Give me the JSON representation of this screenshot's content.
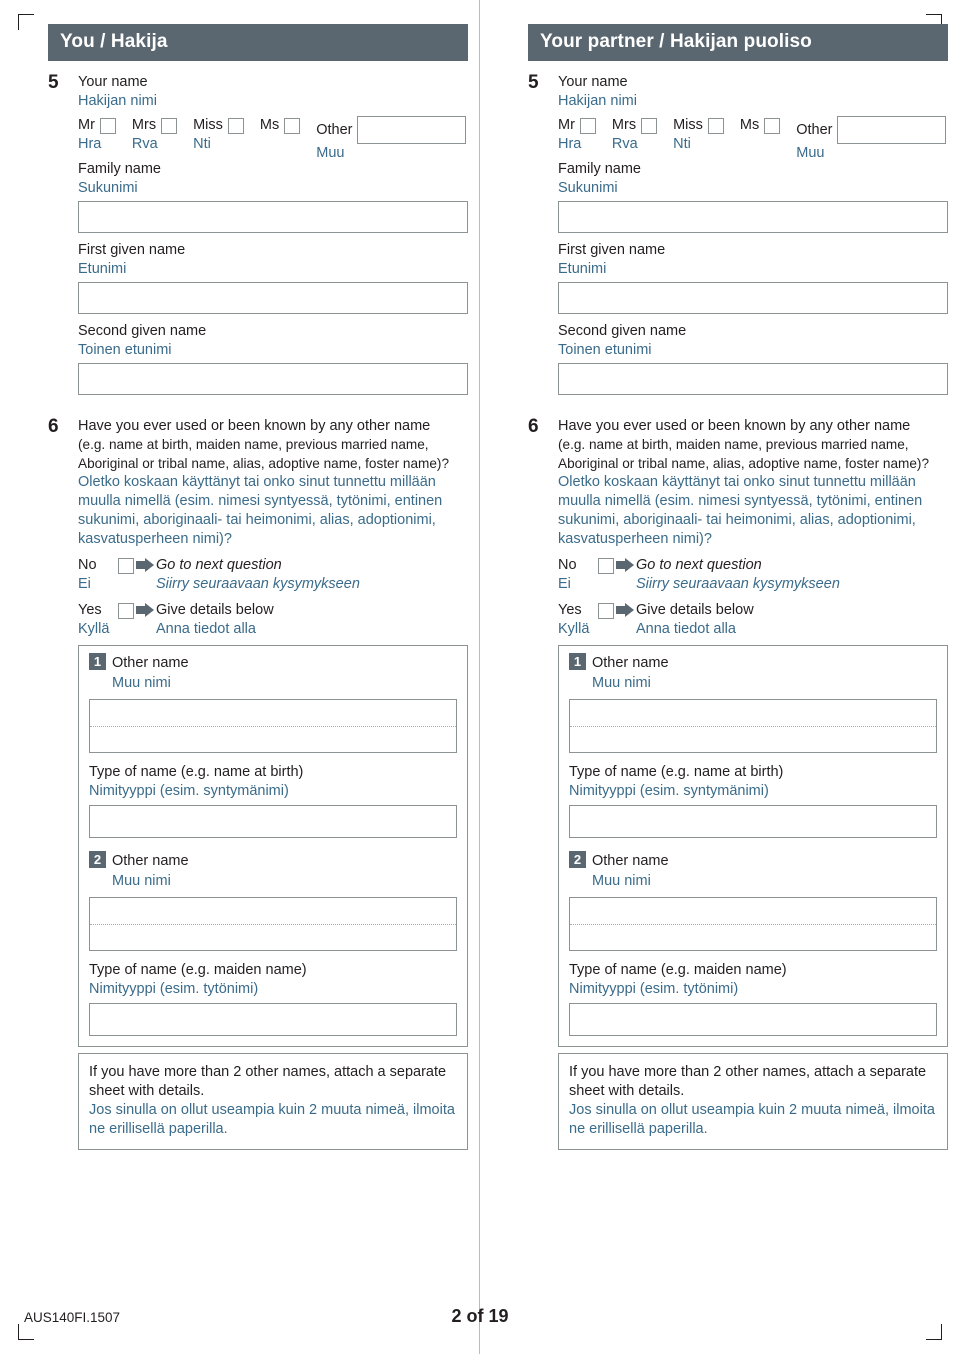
{
  "document": {
    "footer_code": "AUS140FI.1507",
    "page_label": "2 of 19",
    "accent_color": "#5b6770",
    "finnish_text_color": "#3a6b8a",
    "box_border_color": "#8d9295"
  },
  "columns": [
    {
      "header": "You / Hakija",
      "q5": {
        "number": "5",
        "label_en": "Your name",
        "label_fi": "Hakijan nimi",
        "titles": [
          {
            "en": "Mr",
            "fi": "Hra"
          },
          {
            "en": "Mrs",
            "fi": "Rva"
          },
          {
            "en": "Miss",
            "fi": "Nti"
          },
          {
            "en": "Ms",
            "fi": ""
          },
          {
            "en": "Other",
            "fi": "Muu"
          }
        ],
        "family_name_en": "Family name",
        "family_name_fi": "Sukunimi",
        "first_given_en": "First given name",
        "first_given_fi": "Etunimi",
        "second_given_en": "Second given name",
        "second_given_fi": "Toinen etunimi"
      },
      "q6": {
        "number": "6",
        "question_en_1": "Have you ever used or been known by any other name",
        "question_en_2": "(e.g. name at birth, maiden name, previous married name,",
        "question_en_3": "Aboriginal or tribal name, alias, adoptive name, foster name)?",
        "question_fi_1": "Oletko koskaan käyttänyt tai onko sinut tunnettu millään",
        "question_fi_2": "muulla nimellä (esim. nimesi syntyessä, tytönimi, entinen",
        "question_fi_3": "sukunimi, aboriginaali- tai heimonimi, alias, adoptionimi,",
        "question_fi_4": "kasvatusperheen nimi)?",
        "no_en": "No",
        "no_fi": "Ei",
        "no_action_en": "Go to next question",
        "no_action_fi": "Siirry seuraavaan kysymykseen",
        "yes_en": "Yes",
        "yes_fi": "Kyllä",
        "yes_action_en": "Give details below",
        "yes_action_fi": "Anna tiedot alla",
        "name1": {
          "chip": "1",
          "label_en": "Other name",
          "label_fi": "Muu nimi",
          "type_en": "Type of name (e.g. name at birth)",
          "type_fi": "Nimityyppi (esim. syntymänimi)"
        },
        "name2": {
          "chip": "2",
          "label_en": "Other name",
          "label_fi": "Muu nimi",
          "type_en": "Type of name (e.g. maiden name)",
          "type_fi": "Nimityyppi (esim. tytönimi)"
        },
        "note_en_1": "If you have more than 2 other names, attach a separate",
        "note_en_2": "sheet with details.",
        "note_fi_1": "Jos sinulla on ollut useampia kuin 2 muuta nimeä, ilmoita",
        "note_fi_2": "ne erillisellä paperilla."
      }
    },
    {
      "header": "Your partner / Hakijan puoliso",
      "q5": {
        "number": "5",
        "label_en": "Your name",
        "label_fi": "Hakijan nimi",
        "titles": [
          {
            "en": "Mr",
            "fi": "Hra"
          },
          {
            "en": "Mrs",
            "fi": "Rva"
          },
          {
            "en": "Miss",
            "fi": "Nti"
          },
          {
            "en": "Ms",
            "fi": ""
          },
          {
            "en": "Other",
            "fi": "Muu"
          }
        ],
        "family_name_en": "Family name",
        "family_name_fi": "Sukunimi",
        "first_given_en": "First given name",
        "first_given_fi": "Etunimi",
        "second_given_en": "Second given name",
        "second_given_fi": "Toinen etunimi"
      },
      "q6": {
        "number": "6",
        "question_en_1": "Have you ever used or been known by any other name",
        "question_en_2": "(e.g. name at birth, maiden name, previous married name,",
        "question_en_3": "Aboriginal or tribal name, alias, adoptive name, foster name)?",
        "question_fi_1": "Oletko koskaan käyttänyt tai onko sinut tunnettu millään",
        "question_fi_2": "muulla nimellä (esim. nimesi syntyessä, tytönimi, entinen",
        "question_fi_3": "sukunimi, aboriginaali- tai heimonimi, alias, adoptionimi,",
        "question_fi_4": "kasvatusperheen nimi)?",
        "no_en": "No",
        "no_fi": "Ei",
        "no_action_en": "Go to next question",
        "no_action_fi": "Siirry seuraavaan kysymykseen",
        "yes_en": "Yes",
        "yes_fi": "Kyllä",
        "yes_action_en": "Give details below",
        "yes_action_fi": "Anna tiedot alla",
        "name1": {
          "chip": "1",
          "label_en": "Other name",
          "label_fi": "Muu nimi",
          "type_en": "Type of name (e.g. name at birth)",
          "type_fi": "Nimityyppi (esim. syntymänimi)"
        },
        "name2": {
          "chip": "2",
          "label_en": "Other name",
          "label_fi": "Muu nimi",
          "type_en": "Type of name (e.g. maiden name)",
          "type_fi": "Nimityyppi (esim. tytönimi)"
        },
        "note_en_1": "If you have more than 2 other names, attach a separate",
        "note_en_2": "sheet with details.",
        "note_fi_1": "Jos sinulla on ollut useampia kuin 2 muuta nimeä, ilmoita",
        "note_fi_2": "ne erillisellä paperilla."
      }
    }
  ]
}
